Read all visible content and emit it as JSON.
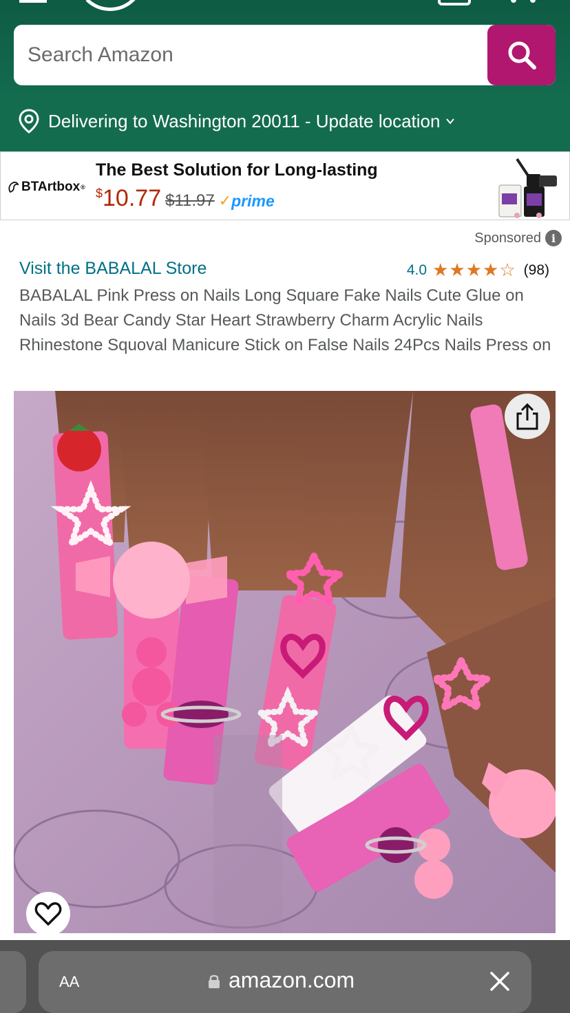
{
  "search": {
    "placeholder": "Search Amazon"
  },
  "location": {
    "text": "Delivering to Washington 20011 - Update location"
  },
  "ad": {
    "brand": "BTArtbox",
    "title": "The Best Solution for Long-lasting",
    "currency": "$",
    "price": "10.77",
    "old_price": "$11.97",
    "prime_label": "prime"
  },
  "product": {
    "sponsored": "Sponsored",
    "store_link": "Visit the BABALAL Store",
    "rating": "4.0",
    "stars": 4.0,
    "review_count": "(98)",
    "title": "BABALAL Pink Press on Nails Long Square Fake Nails Cute Glue on Nails 3d Bear Candy Star Heart Strawberry Charm Acrylic Nails Rhinestone Squoval Manicure Stick on False Nails 24Pcs Nails Press on"
  },
  "browser": {
    "text_size": "AA",
    "url": "amazon.com"
  },
  "colors": {
    "header": "#0e5b43",
    "location_bar": "#146c4f",
    "search_button": "#b1176e",
    "link": "#007185",
    "price": "#b12704",
    "star": "#de7921"
  }
}
